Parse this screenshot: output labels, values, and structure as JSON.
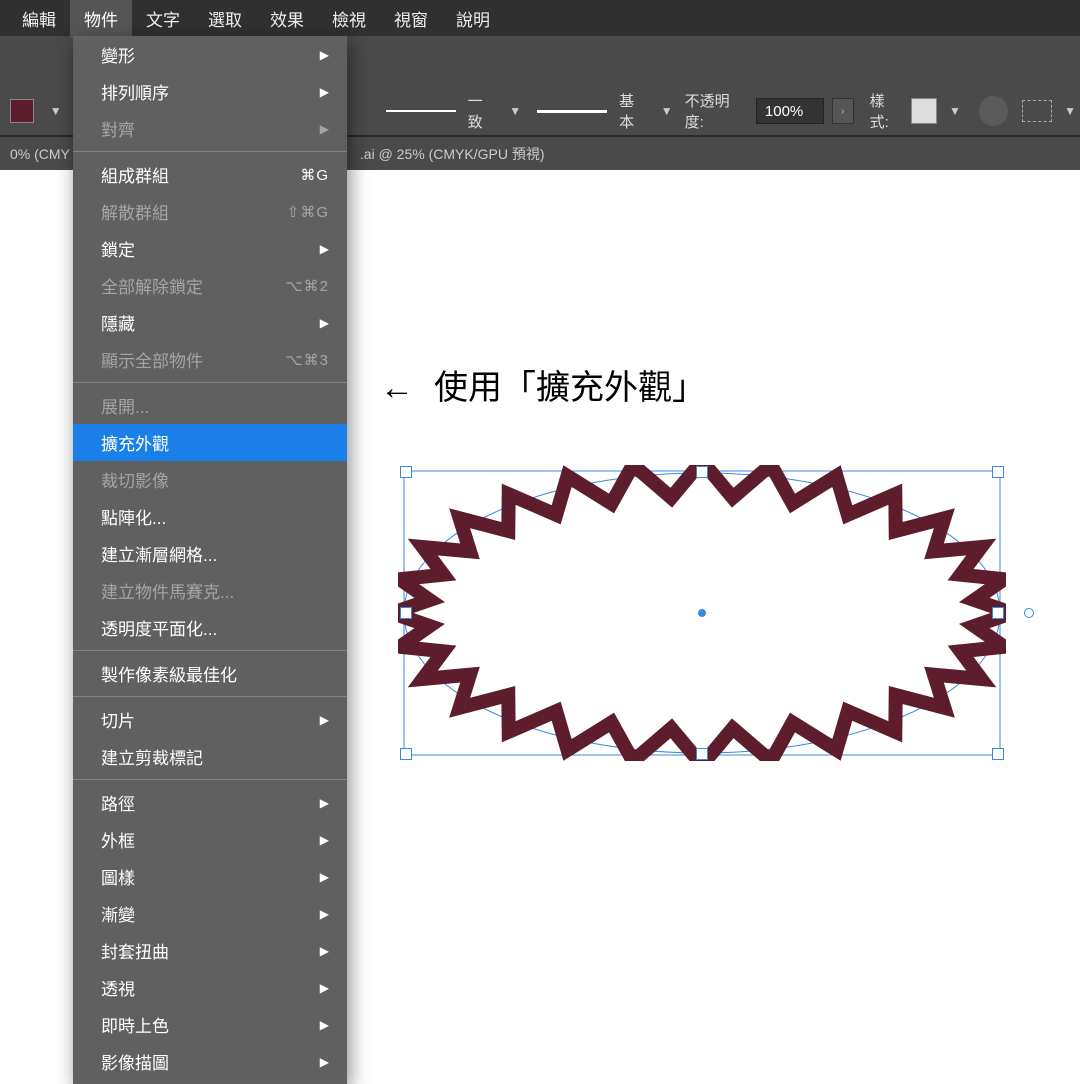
{
  "menubar": [
    "編輯",
    "物件",
    "文字",
    "選取",
    "效果",
    "檢視",
    "視窗",
    "說明"
  ],
  "active_menu_index": 1,
  "options_bar": {
    "stroke_style_label": "一致",
    "brush_style_label": "基本",
    "opacity_label": "不透明度:",
    "opacity_value": "100%",
    "style_label": "樣式:"
  },
  "tab": {
    "left_fragment": "0% (CMY",
    "right_fragment": ".ai @ 25% (CMYK/GPU 預視)"
  },
  "dropdown": {
    "items": [
      {
        "label": "變形",
        "submenu": true
      },
      {
        "label": "排列順序",
        "submenu": true
      },
      {
        "label": "對齊",
        "submenu": true,
        "disabled": true
      },
      {
        "sep": true
      },
      {
        "label": "組成群組",
        "shortcut": "⌘G"
      },
      {
        "label": "解散群組",
        "shortcut": "⇧⌘G",
        "disabled": true
      },
      {
        "label": "鎖定",
        "submenu": true
      },
      {
        "label": "全部解除鎖定",
        "shortcut": "⌥⌘2",
        "disabled": true
      },
      {
        "label": "隱藏",
        "submenu": true
      },
      {
        "label": "顯示全部物件",
        "shortcut": "⌥⌘3",
        "disabled": true
      },
      {
        "sep": true
      },
      {
        "label": "展開...",
        "disabled": true
      },
      {
        "label": "擴充外觀",
        "highlight": true
      },
      {
        "label": "裁切影像",
        "disabled": true
      },
      {
        "label": "點陣化..."
      },
      {
        "label": "建立漸層網格..."
      },
      {
        "label": "建立物件馬賽克...",
        "disabled": true
      },
      {
        "label": "透明度平面化..."
      },
      {
        "sep": true
      },
      {
        "label": "製作像素級最佳化"
      },
      {
        "sep": true
      },
      {
        "label": "切片",
        "submenu": true
      },
      {
        "label": "建立剪裁標記"
      },
      {
        "sep": true
      },
      {
        "label": "路徑",
        "submenu": true
      },
      {
        "label": "外框",
        "submenu": true
      },
      {
        "label": "圖樣",
        "submenu": true
      },
      {
        "label": "漸變",
        "submenu": true
      },
      {
        "label": "封套扭曲",
        "submenu": true
      },
      {
        "label": "透視",
        "submenu": true
      },
      {
        "label": "即時上色",
        "submenu": true
      },
      {
        "label": "影像描圖",
        "submenu": true
      }
    ]
  },
  "canvas_annotation": "使用「擴充外觀」",
  "colors": {
    "shape_stroke": "#5d1d2c",
    "selection": "#3b8ad9"
  }
}
